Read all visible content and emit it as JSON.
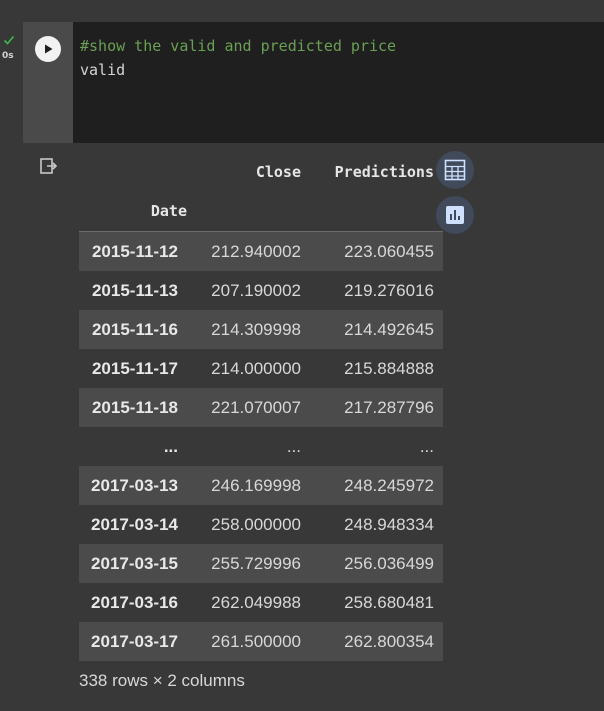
{
  "cell": {
    "status_time": "0s",
    "code_lines": [
      "#show the valid and predicted price",
      "valid"
    ]
  },
  "dataframe": {
    "columns": [
      "Close",
      "Predictions"
    ],
    "index_name": "Date",
    "rows": [
      {
        "index": "2015-11-12",
        "values": [
          "212.940002",
          "223.060455"
        ]
      },
      {
        "index": "2015-11-13",
        "values": [
          "207.190002",
          "219.276016"
        ]
      },
      {
        "index": "2015-11-16",
        "values": [
          "214.309998",
          "214.492645"
        ]
      },
      {
        "index": "2015-11-17",
        "values": [
          "214.000000",
          "215.884888"
        ]
      },
      {
        "index": "2015-11-18",
        "values": [
          "221.070007",
          "217.287796"
        ]
      },
      {
        "index": "...",
        "values": [
          "...",
          "..."
        ]
      },
      {
        "index": "2017-03-13",
        "values": [
          "246.169998",
          "248.245972"
        ]
      },
      {
        "index": "2017-03-14",
        "values": [
          "258.000000",
          "248.948334"
        ]
      },
      {
        "index": "2017-03-15",
        "values": [
          "255.729996",
          "256.036499"
        ]
      },
      {
        "index": "2017-03-16",
        "values": [
          "262.049988",
          "258.680481"
        ]
      },
      {
        "index": "2017-03-17",
        "values": [
          "261.500000",
          "262.800354"
        ]
      }
    ],
    "shape_text": "338 rows × 2 columns"
  },
  "icons": {
    "status": "checkmark-icon",
    "run": "play-icon",
    "output": "output-action-icon",
    "table_button": "table-icon",
    "chart_button": "bar-chart-icon"
  },
  "colors": {
    "background": "#383838",
    "editor": "#1f1f1f",
    "comment": "#6a9f55",
    "check": "#3fb950",
    "button_bg": "#404a5a",
    "button_icon": "#cfe0ff"
  }
}
